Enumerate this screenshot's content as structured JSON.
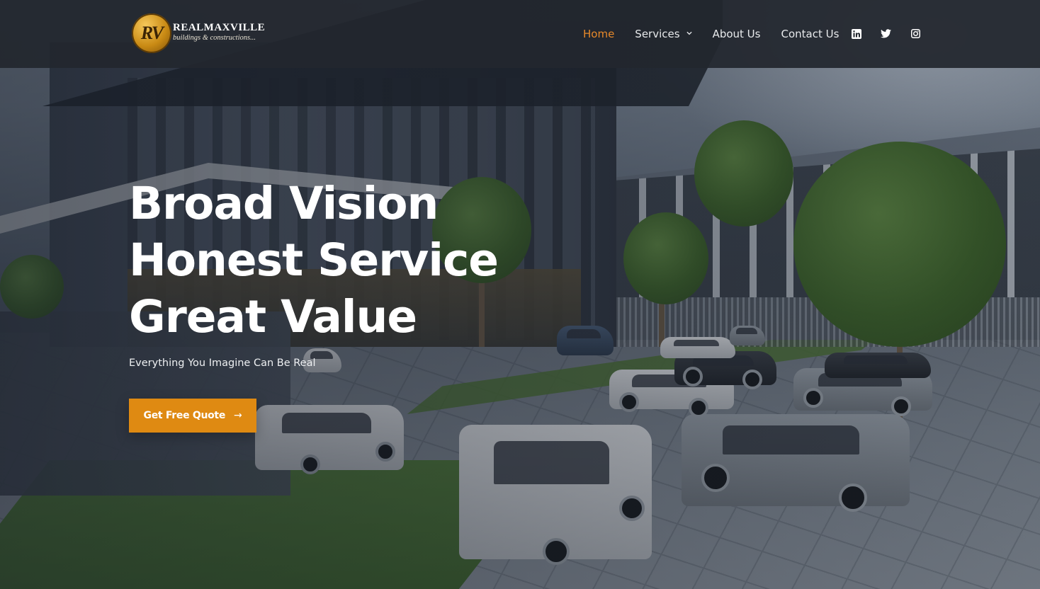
{
  "brand": {
    "mark": "RV",
    "name": "REALMAXVILLE",
    "tagline": "buildings & constructions...",
    "accent_color": "#df8a12"
  },
  "nav": {
    "items": [
      {
        "label": "Home",
        "active": true
      },
      {
        "label": "Services",
        "has_dropdown": true
      },
      {
        "label": "About Us"
      },
      {
        "label": "Contact Us"
      }
    ]
  },
  "social": [
    {
      "icon": "linkedin-icon"
    },
    {
      "icon": "twitter-icon"
    },
    {
      "icon": "instagram-icon"
    }
  ],
  "hero": {
    "headline": [
      "Broad Vision",
      "Honest Service",
      "Great Value"
    ],
    "subtitle": "Everything You Imagine Can Be Real",
    "cta_label": "Get Free Quote",
    "cta_arrow": "→"
  }
}
